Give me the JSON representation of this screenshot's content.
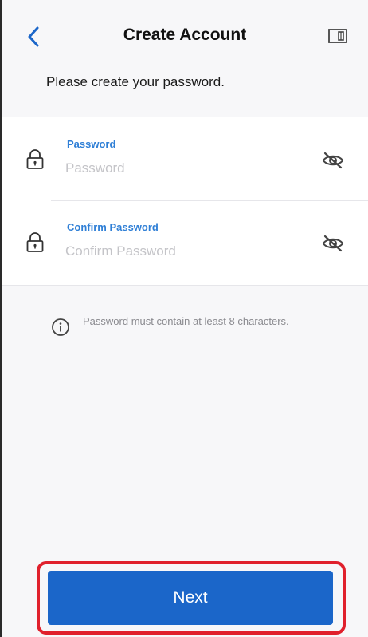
{
  "header": {
    "title": "Create Account",
    "back_icon": "chevron-left-icon",
    "doc_icon": "document-icon"
  },
  "subtitle": "Please create your password.",
  "form": {
    "password": {
      "label": "Password",
      "placeholder": "Password",
      "value": "",
      "icon": "lock-icon",
      "toggle_icon": "eye-slash-icon"
    },
    "confirm_password": {
      "label": "Confirm Password",
      "placeholder": "Confirm Password",
      "value": "",
      "icon": "lock-icon",
      "toggle_icon": "eye-slash-icon"
    }
  },
  "hint": {
    "icon": "info-icon",
    "text": "Password must contain at least 8 characters."
  },
  "next_button": {
    "label": "Next",
    "color": "#1b66c9",
    "highlight_color": "#e0202c"
  },
  "colors": {
    "accent": "#2f7fd6",
    "background": "#f7f7f9"
  }
}
